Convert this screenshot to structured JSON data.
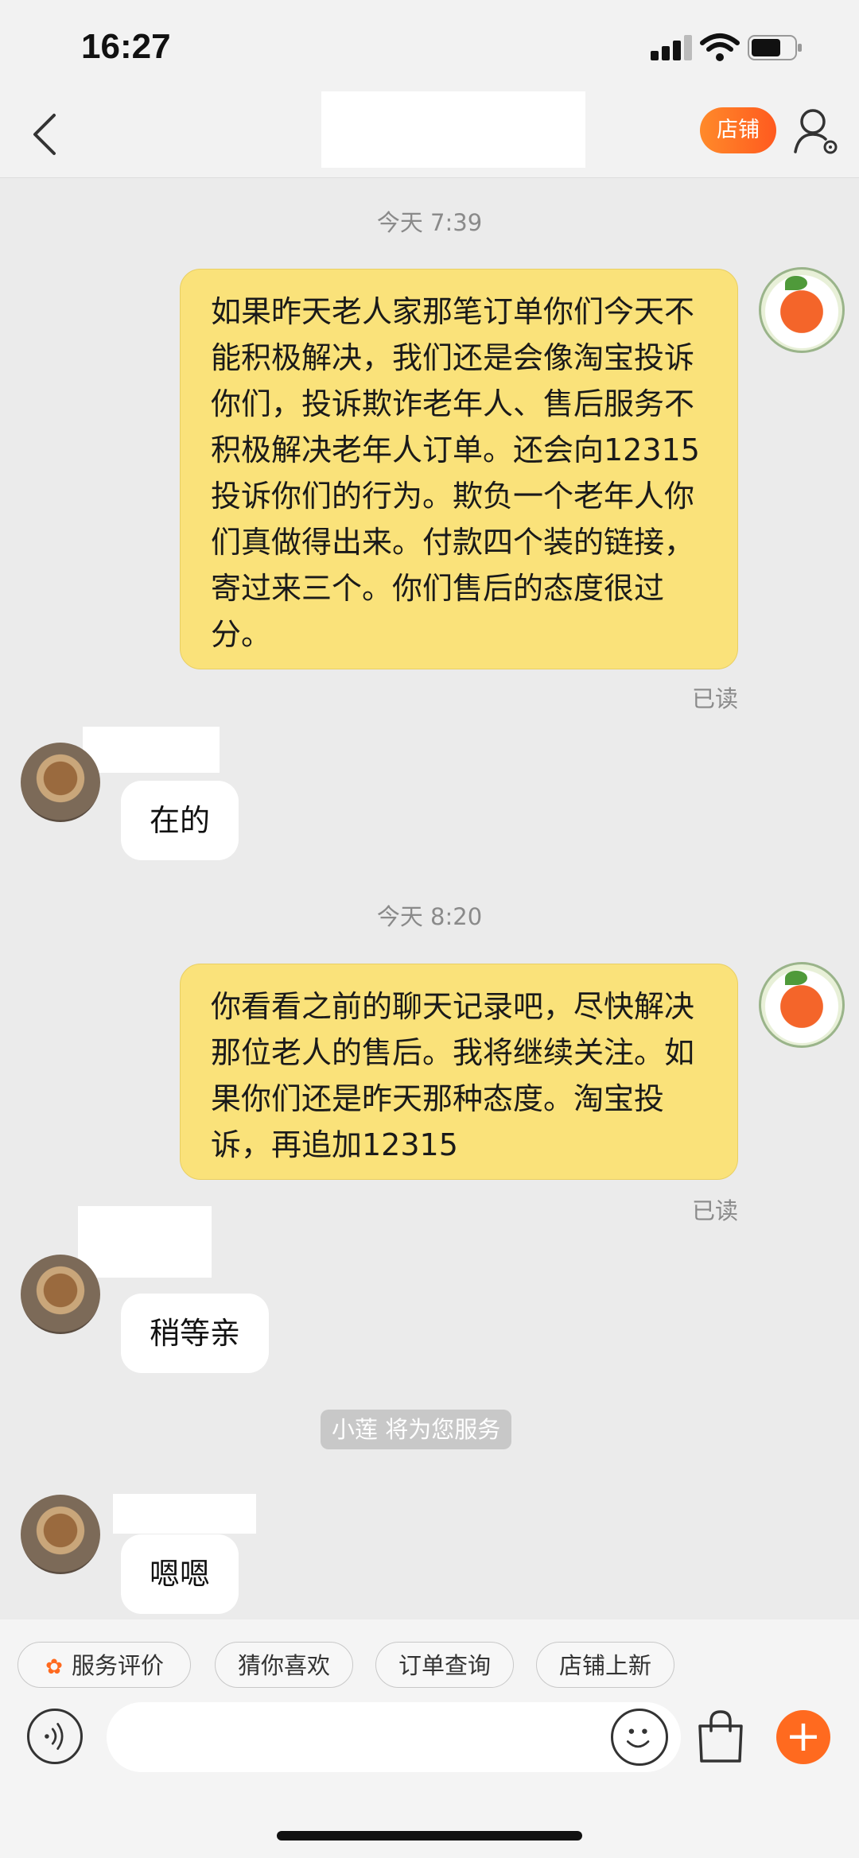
{
  "status_bar": {
    "time": "16:27"
  },
  "nav": {
    "shop_button": "店铺"
  },
  "messages": [
    {
      "timestamp": "今天 7:39"
    },
    {
      "from": "me",
      "text": "如果昨天老人家那笔订单你们今天不能积极解决，我们还是会像淘宝投诉你们，投诉欺诈老年人、售后服务不积极解决老年人订单。还会向12315投诉你们的行为。欺负一个老年人你们真做得出来。付款四个装的链接，寄过来三个。你们售后的态度很过分。",
      "status": "已读"
    },
    {
      "from": "shop",
      "text": "在的"
    },
    {
      "timestamp": "今天 8:20"
    },
    {
      "from": "me",
      "text": "你看看之前的聊天记录吧，尽快解决那位老人的售后。我将继续关注。如果你们还是昨天那种态度。淘宝投诉，再追加12315",
      "status": "已读"
    },
    {
      "from": "shop",
      "text": "稍等亲"
    },
    {
      "notice": "小莲 将为您服务"
    },
    {
      "from": "shop",
      "text": "嗯嗯"
    }
  ],
  "quick_actions": [
    "服务评价",
    "猜你喜欢",
    "订单查询",
    "店铺上新"
  ],
  "icons": {
    "back": "chevron-left-icon",
    "user_settings": "user-settings-icon",
    "voice": "voice-icon",
    "emoji": "emoji-icon",
    "bag": "shopping-bag-icon",
    "plus": "plus-icon"
  },
  "colors": {
    "accent": "#ff6a1f",
    "my_bubble": "#fae27a",
    "background": "#ebebeb"
  }
}
